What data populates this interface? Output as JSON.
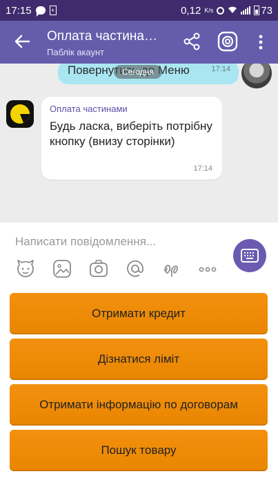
{
  "statusbar": {
    "time": "17:15",
    "speed": "0,12",
    "speed_unit": "K/s",
    "battery": "73"
  },
  "header": {
    "title": "Оплата частина…",
    "subtitle": "Паблік акаунт"
  },
  "chat": {
    "date_pill": "Сегодня",
    "outgoing": {
      "text": "Повернутись до Меню",
      "time": "17:14"
    },
    "incoming": {
      "sender": "Оплата частинами",
      "text": "Будь ласка, виберіть потрібну кнопку (внизу сторінки)",
      "time": "17:14"
    }
  },
  "composer": {
    "placeholder": "Написати повідомлення...",
    "tools": [
      "sticker-icon",
      "gallery-icon",
      "camera-icon",
      "mention-icon",
      "doodle-icon",
      "more-icon"
    ]
  },
  "keyboard": {
    "buttons": [
      "Отримати кредит",
      "Дізнатися ліміт",
      "Отримати інформацію по договорам",
      "Пошук товару"
    ]
  },
  "colors": {
    "header": "#665cac",
    "statusbar": "#3f2b6d",
    "button": "#ef8c07",
    "outgoing_bubble": "#a9e6f2",
    "sender": "#5e4ea6"
  }
}
